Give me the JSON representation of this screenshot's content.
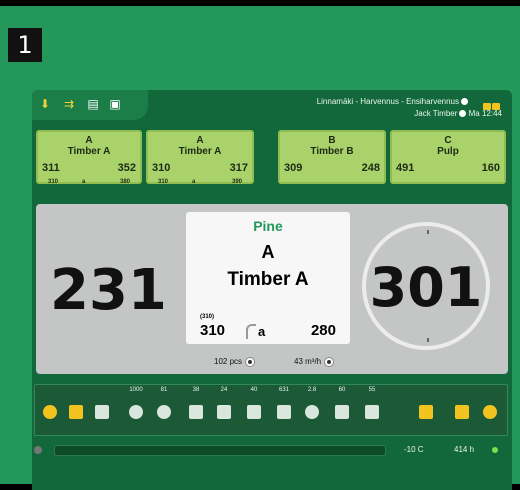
{
  "step_number": "1",
  "header": {
    "location_line": "Linnamäki - Harvennus - Ensiharvennus",
    "operator_line": "Jack Timber",
    "datetime": "Ma 12:44"
  },
  "assortments": [
    {
      "code": "A",
      "name": "Timber A",
      "count_left": "311",
      "count_right": "352",
      "sub_left": "310",
      "sub_grade": "a",
      "sub_right": "380"
    },
    {
      "code": "A",
      "name": "Timber A",
      "count_left": "310",
      "count_right": "317",
      "sub_left": "310",
      "sub_grade": "a",
      "sub_right": "390"
    },
    {
      "code": "B",
      "name": "Timber B",
      "count_left": "309",
      "count_right": "248",
      "sub_left": "",
      "sub_grade": "",
      "sub_right": ""
    },
    {
      "code": "C",
      "name": "Pulp",
      "count_left": "491",
      "count_right": "160",
      "sub_left": "",
      "sub_grade": "",
      "sub_right": ""
    }
  ],
  "measurement": {
    "diameter": "231",
    "length": "301",
    "species": "Pine",
    "code": "A",
    "name": "Timber A",
    "sub_label": "(310)",
    "value1": "310",
    "grade": "a",
    "value2": "280",
    "pcs": "102 pcs",
    "volume": "43 m³/h"
  },
  "tool_values": [
    "",
    "",
    "",
    "1000",
    "81",
    "38",
    "24",
    "40",
    "631",
    "2.8",
    "60",
    "55",
    "",
    ""
  ],
  "status": {
    "temperature": "-10 C",
    "hours": "414 h"
  },
  "colors": {
    "frame": "#24985a",
    "app": "#12683a",
    "card": "#a9d36a",
    "accent": "#f2c21e"
  }
}
